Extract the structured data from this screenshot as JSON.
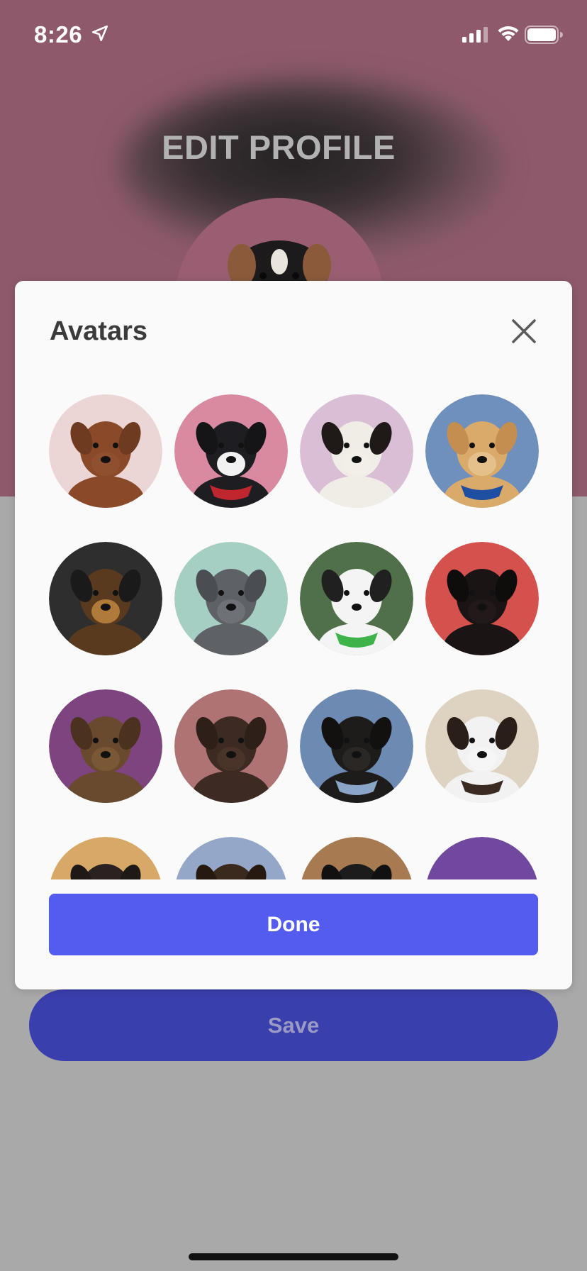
{
  "status_bar": {
    "time": "8:26",
    "icons": [
      "location-arrow-icon",
      "cellular-signal-icon",
      "wifi-icon",
      "battery-icon"
    ]
  },
  "screen": {
    "title": "EDIT PROFILE",
    "save_label": "Save",
    "header_color": "#8e5a6b",
    "save_color": "#3a3fae"
  },
  "modal": {
    "title": "Avatars",
    "close_icon": "close-icon",
    "done_label": "Done",
    "done_color": "#545cf0",
    "avatars": [
      {
        "bg": "#ecd5d5",
        "dog": "#8a4a2a",
        "ear": "#6e3a20",
        "muzzle": "#8f5030"
      },
      {
        "bg": "#d98aa0",
        "dog": "#1e1e22",
        "ear": "#151518",
        "muzzle": "#f2f2f2",
        "accent": "#c0262e"
      },
      {
        "bg": "#d9bed5",
        "dog": "#f0ece6",
        "ear": "#1f1a18",
        "muzzle": "#f3efe8"
      },
      {
        "bg": "#6f8fbd",
        "dog": "#d9aa6a",
        "ear": "#c48e50",
        "muzzle": "#e6c08a",
        "accent": "#1e4fa0"
      },
      {
        "bg": "#2e2e2e",
        "dog": "#5a3a1e",
        "ear": "#1a1a1a",
        "muzzle": "#b07a3a"
      },
      {
        "bg": "#a5cfc2",
        "dog": "#5e6266",
        "ear": "#4a4e52",
        "muzzle": "#6e7276"
      },
      {
        "bg": "#4f7048",
        "dog": "#f4f4f4",
        "ear": "#202020",
        "muzzle": "#f4f4f4",
        "accent": "#3db34a"
      },
      {
        "bg": "#d4514d",
        "dog": "#1a1414",
        "ear": "#0f0c0c",
        "muzzle": "#221a1a"
      },
      {
        "bg": "#7d4480",
        "dog": "#6a4a2e",
        "ear": "#4a321e",
        "muzzle": "#7a5836"
      },
      {
        "bg": "#b07373",
        "dog": "#3d2a22",
        "ear": "#2e1f19",
        "muzzle": "#4a3328"
      },
      {
        "bg": "#6d8ab3",
        "dog": "#1e1c1a",
        "ear": "#121110",
        "muzzle": "#2a2725",
        "accent": "#8aa5c8"
      },
      {
        "bg": "#ddd3c0",
        "dog": "#f2f2f2",
        "ear": "#2a1e18",
        "muzzle": "#f6f6f6",
        "accent": "#3a2a22"
      },
      {
        "bg": "#d8a866",
        "dog": "#2a2220",
        "ear": "#1e1816",
        "muzzle": "#2a2220"
      },
      {
        "bg": "#94a7c8",
        "dog": "#3a2a1e",
        "ear": "#26190f",
        "muzzle": "#3a2a1e"
      },
      {
        "bg": "#a87a52",
        "dog": "#1c1c1c",
        "ear": "#111111",
        "muzzle": "#1c1c1c"
      },
      {
        "bg": "#7048a0",
        "dog": "#7048a0",
        "ear": "#7048a0",
        "muzzle": "#7048a0"
      }
    ]
  }
}
